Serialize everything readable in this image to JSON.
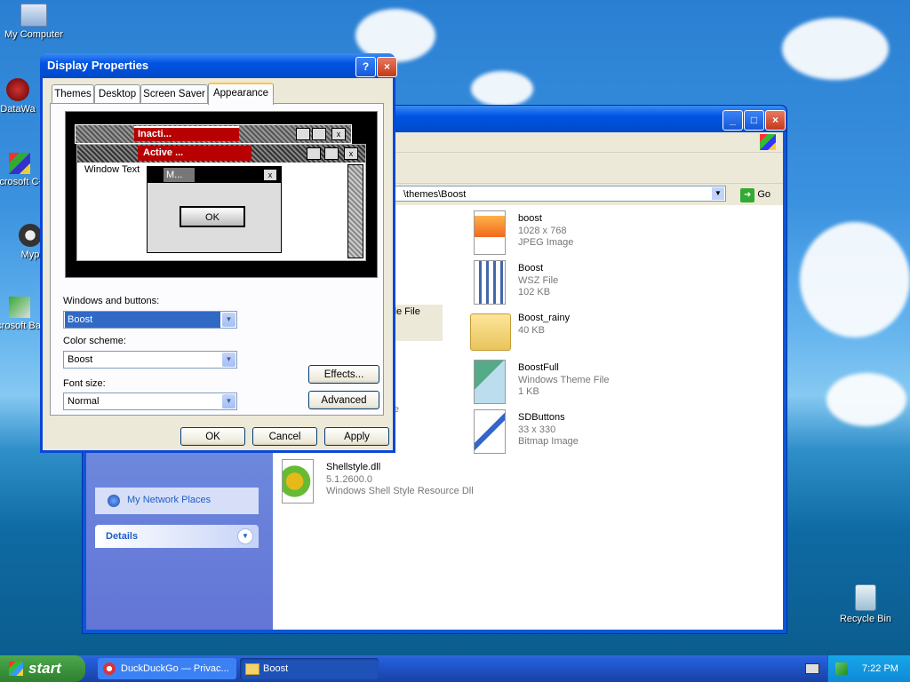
{
  "desktop": {
    "icons": [
      {
        "label": "My Computer"
      },
      {
        "label": "DataWa"
      },
      {
        "label": "Microsoft C++"
      },
      {
        "label": "Myp"
      },
      {
        "label": "Microsoft Basic"
      },
      {
        "label": "Recycle Bin"
      }
    ]
  },
  "explorer": {
    "address_visible": "\\themes\\Boost",
    "go_label": "Go",
    "partial_labels": {
      "style_file": "yle File",
      "ile": "ile"
    },
    "side": {
      "network_link": "My Network Places",
      "details_header": "Details"
    },
    "files": [
      {
        "name": "boost",
        "meta1": "1028 x 768",
        "meta2": "JPEG Image",
        "icon": "jpeg-icon"
      },
      {
        "name": "Boost",
        "meta1": "WSZ File",
        "meta2": "102 KB",
        "icon": "wsz-file-icon"
      },
      {
        "name": "Boost_rainy",
        "meta1": "40 KB",
        "meta2": "",
        "icon": "zip-folder-icon"
      },
      {
        "name": "BoostFull",
        "meta1": "Windows Theme File",
        "meta2": "1 KB",
        "icon": "theme-file-icon"
      },
      {
        "name": "SDButtons",
        "meta1": "33 x 330",
        "meta2": "Bitmap Image",
        "icon": "bitmap-icon"
      },
      {
        "name": "Shellstyle.dll",
        "meta1": "5.1.2600.0",
        "meta2": "Windows Shell Style Resource Dll",
        "icon": "dll-icon"
      }
    ]
  },
  "dialog": {
    "title": "Display Properties",
    "tabs": [
      "Themes",
      "Desktop",
      "Screen Saver",
      "Appearance"
    ],
    "active_tab": "Appearance",
    "preview": {
      "inactive_title": "Inacti...",
      "active_title": "Active ...",
      "window_text": "Window Text",
      "msg_title": "M...",
      "ok_label": "OK"
    },
    "windows_buttons_label": "Windows and buttons:",
    "windows_buttons_value": "Boost",
    "color_scheme_label": "Color scheme:",
    "color_scheme_value": "Boost",
    "font_size_label": "Font size:",
    "font_size_value": "Normal",
    "effects_label": "Effects...",
    "advanced_label": "Advanced",
    "ok_label": "OK",
    "cancel_label": "Cancel",
    "apply_label": "Apply"
  },
  "taskbar": {
    "start_label": "start",
    "tasks": [
      {
        "label": "DuckDuckGo — Privac..."
      },
      {
        "label": "Boost"
      }
    ],
    "clock": "7:22 PM"
  },
  "colors": {
    "xp_blue": "#0054e3",
    "preview_red": "#b80000",
    "selection": "#316ac5"
  }
}
